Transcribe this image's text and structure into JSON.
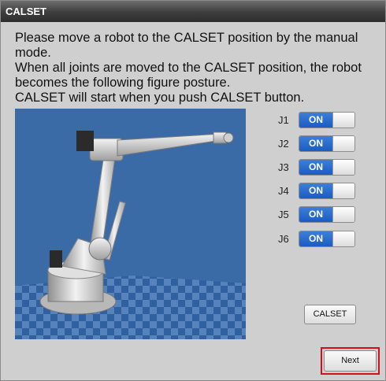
{
  "window": {
    "title": "CALSET"
  },
  "instructions": [
    "Please move a robot to the CALSET position by the manual",
    "mode.",
    "When all joints are moved to the CALSET position, the robot",
    "becomes the following figure posture.",
    "CALSET will start when you push CALSET button."
  ],
  "joints": [
    {
      "label": "J1",
      "state": "ON"
    },
    {
      "label": "J2",
      "state": "ON"
    },
    {
      "label": "J3",
      "state": "ON"
    },
    {
      "label": "J4",
      "state": "ON"
    },
    {
      "label": "J5",
      "state": "ON"
    },
    {
      "label": "J6",
      "state": "ON"
    }
  ],
  "buttons": {
    "calset": "CALSET",
    "next": "Next"
  },
  "colors": {
    "toggle_on": "#1f62c7",
    "viewport_bg": "#3a6ba7",
    "highlight": "#d0101a"
  }
}
